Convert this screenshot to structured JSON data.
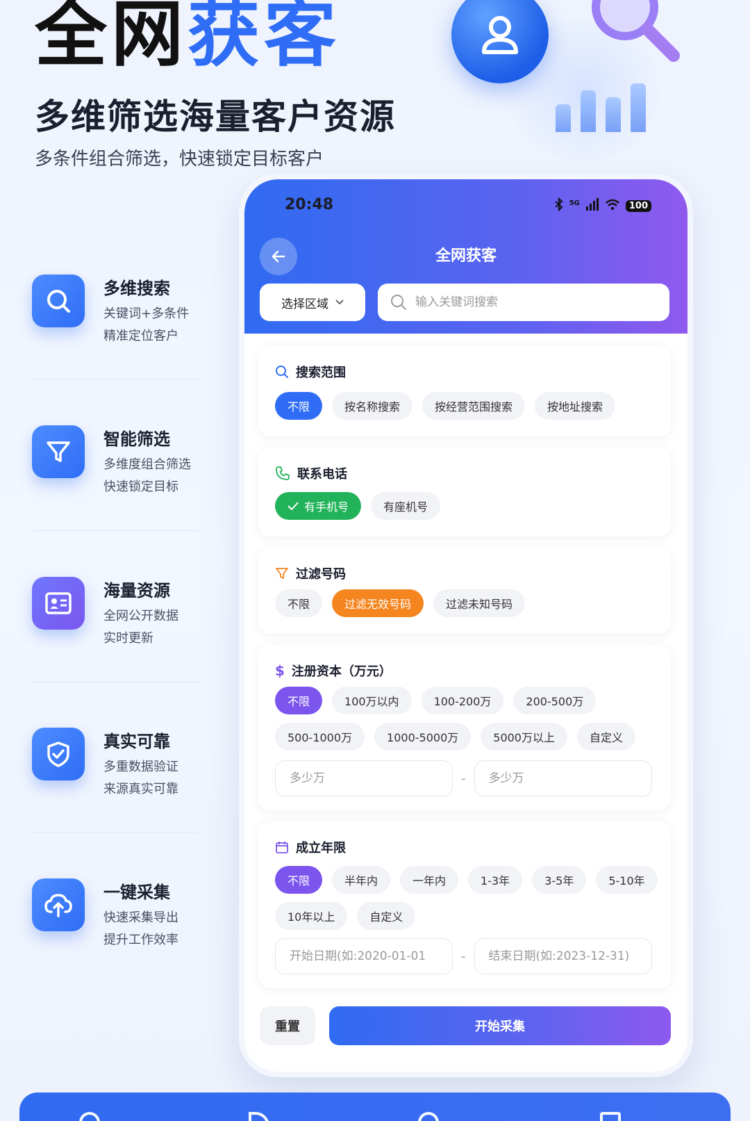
{
  "hero": {
    "title_part1": "全网",
    "title_part2": "获客",
    "subtitle": "多维筛选海量客户资源",
    "description": "多条件组合筛选，快速锁定目标客户"
  },
  "features": [
    {
      "title": "多维搜索",
      "line1": "关键词+多条件",
      "line2": "精准定位客户",
      "icon": "search-icon"
    },
    {
      "title": "智能筛选",
      "line1": "多维度组合筛选",
      "line2": "快速锁定目标",
      "icon": "filter-icon"
    },
    {
      "title": "海量资源",
      "line1": "全网公开数据",
      "line2": "实时更新",
      "icon": "id-card-icon"
    },
    {
      "title": "真实可靠",
      "line1": "多重数据验证",
      "line2": "来源真实可靠",
      "icon": "shield-check-icon"
    },
    {
      "title": "一键采集",
      "line1": "快速采集导出",
      "line2": "提升工作效率",
      "icon": "cloud-upload-icon"
    }
  ],
  "phone": {
    "status": {
      "time": "20:48",
      "signal": "5G",
      "battery": "100"
    },
    "title": "全网获客",
    "region_label": "选择区域",
    "search_placeholder": "输入关键词搜索",
    "sections": {
      "scope": {
        "title": "搜索范围",
        "options": [
          "不限",
          "按名称搜索",
          "按经营范围搜索",
          "按地址搜索"
        ]
      },
      "phone": {
        "title": "联系电话",
        "options": [
          "有手机号",
          "有座机号"
        ]
      },
      "filter": {
        "title": "过滤号码",
        "options": [
          "不限",
          "过滤无效号码",
          "过滤未知号码"
        ]
      },
      "capital": {
        "title": "注册资本（万元）",
        "options": [
          "不限",
          "100万以内",
          "100-200万",
          "200-500万",
          "500-1000万",
          "1000-5000万",
          "5000万以上",
          "自定义"
        ],
        "min_placeholder": "多少万",
        "max_placeholder": "多少万",
        "dash": "-"
      },
      "years": {
        "title": "成立年限",
        "options": [
          "不限",
          "半年内",
          "一年内",
          "1-3年",
          "3-5年",
          "5-10年",
          "10年以上",
          "自定义"
        ],
        "start_placeholder": "开始日期(如:2020-01-01",
        "end_placeholder": "结束日期(如:2023-12-31)",
        "dash": "-"
      }
    },
    "reset_label": "重置",
    "start_label": "开始采集"
  },
  "colors": {
    "accent": "#2f6df6",
    "purple": "#7b55ee",
    "green": "#22b35a",
    "orange": "#f5851f"
  }
}
